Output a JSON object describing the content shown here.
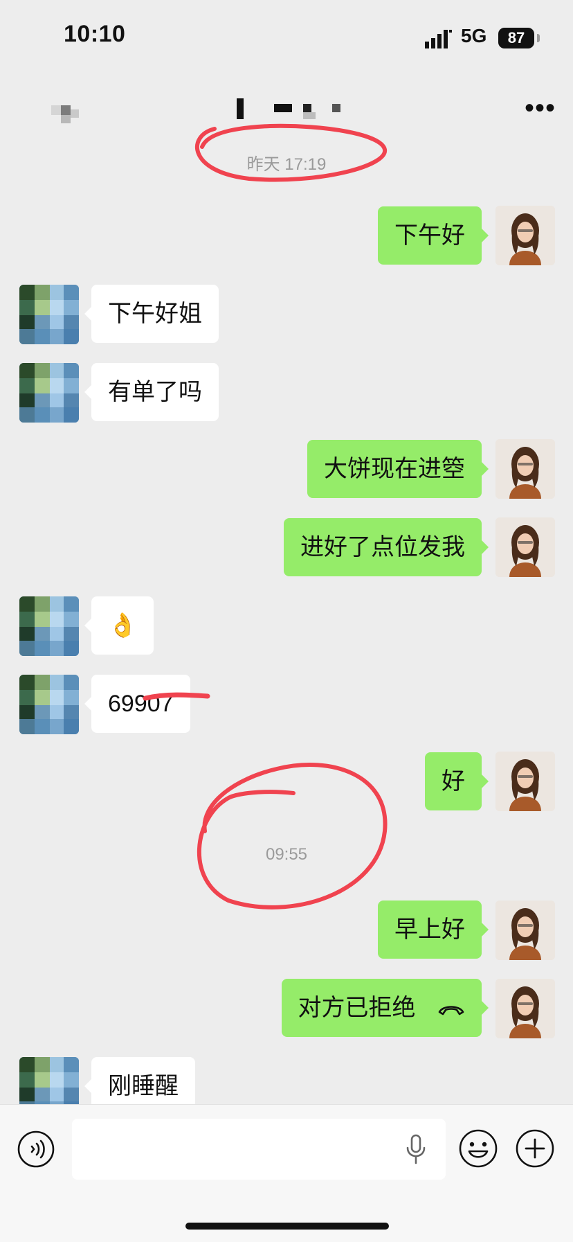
{
  "status_bar": {
    "time": "10:10",
    "network": "5G",
    "battery": "87"
  },
  "nav": {
    "more_icon": "more-dots-icon",
    "back_icon": "back-icon"
  },
  "timestamps": [
    "昨天 17:19",
    "09:55"
  ],
  "messages": [
    {
      "side": "out",
      "text": "下午好"
    },
    {
      "side": "in",
      "text": "下午好姐"
    },
    {
      "side": "in",
      "text": "有单了吗"
    },
    {
      "side": "out",
      "text": "大饼现在进箜"
    },
    {
      "side": "out",
      "text": "进好了点位发我"
    },
    {
      "side": "in",
      "text": "👌"
    },
    {
      "side": "in",
      "text": "69907"
    },
    {
      "side": "out",
      "text": "好"
    },
    {
      "side": "out",
      "text": "早上好"
    },
    {
      "side": "out",
      "text": "对方已拒绝",
      "icon": "hangup-icon"
    },
    {
      "side": "in",
      "text": "刚睡醒"
    }
  ],
  "input_bar": {
    "placeholder": "",
    "icons": [
      "voice-input-icon",
      "microphone-icon",
      "emoji-icon",
      "plus-icon"
    ]
  },
  "colors": {
    "background": "#ededed",
    "outgoing_bubble": "#95ec69",
    "incoming_bubble": "#ffffff",
    "annotation": "#f0434f"
  }
}
